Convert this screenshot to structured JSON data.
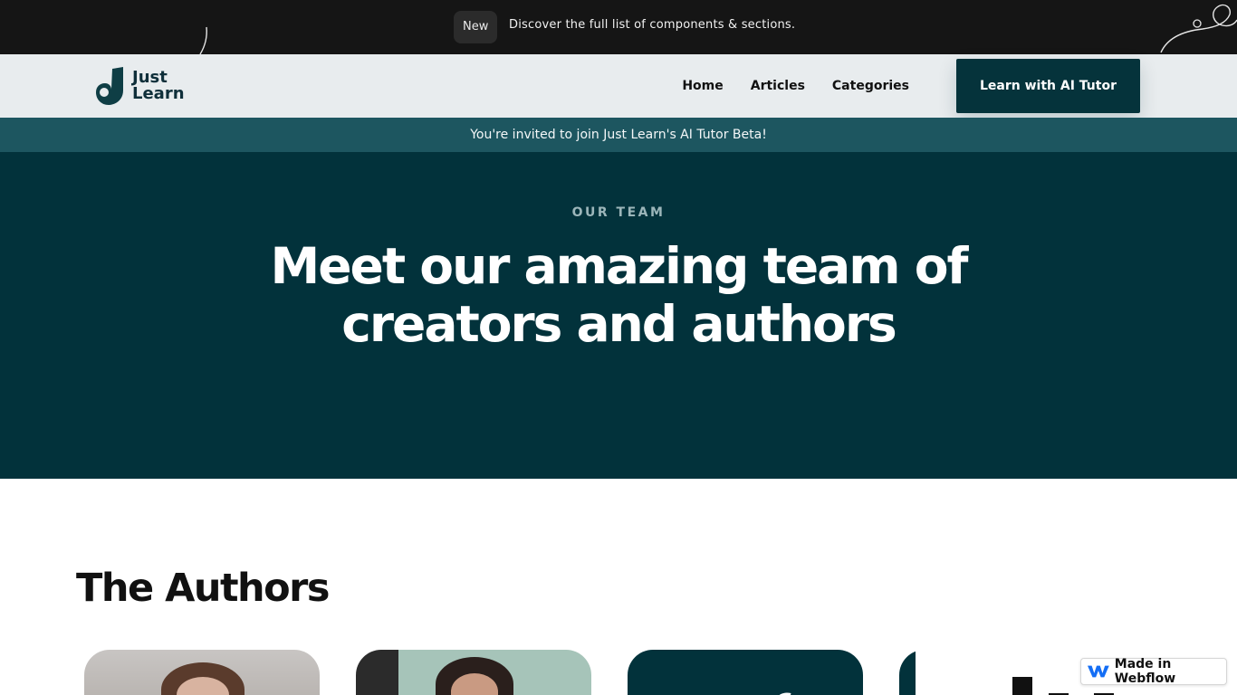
{
  "announcement": {
    "badge": "New",
    "message": "Discover the full list of components & sections."
  },
  "nav": {
    "logo_line1": "Just",
    "logo_line2": "Learn",
    "links": [
      "Home",
      "Articles",
      "Categories"
    ],
    "cta": "Learn with AI Tutor"
  },
  "invite": "You're invited to join Just Learn's AI Tutor Beta!",
  "hero": {
    "eyebrow": "OUR TEAM",
    "title": "Meet our amazing team of creators and authors"
  },
  "authors": {
    "title": "The Authors"
  },
  "badge": {
    "label": "Made in Webflow"
  },
  "colors": {
    "topbar": "#151515",
    "nav": "#e8ecee",
    "brand_dark": "#02323b",
    "invite": "#1d5660"
  }
}
